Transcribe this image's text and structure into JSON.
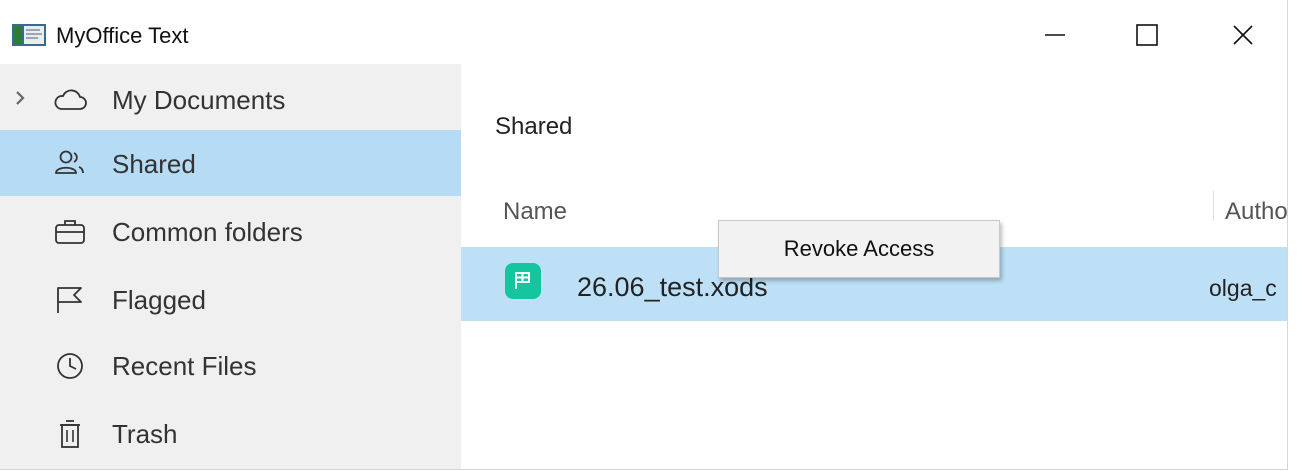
{
  "window": {
    "title": "MyOffice Text",
    "app_icon": "myoffice-text-app-icon",
    "controls": {
      "minimize_icon": "minimize-icon",
      "maximize_icon": "maximize-icon",
      "close_icon": "close-icon"
    }
  },
  "sidebar": {
    "items": [
      {
        "label": "My Documents",
        "icon": "cloud-icon",
        "expandable": true,
        "active": false
      },
      {
        "label": "Shared",
        "icon": "users-icon",
        "active": true
      },
      {
        "label": "Common folders",
        "icon": "briefcase-icon",
        "active": false
      },
      {
        "label": "Flagged",
        "icon": "flag-icon",
        "active": false
      },
      {
        "label": "Recent Files",
        "icon": "clock-icon",
        "active": false
      },
      {
        "label": "Trash",
        "icon": "trash-icon",
        "active": false
      }
    ]
  },
  "main": {
    "title": "Shared",
    "columns": {
      "name": "Name",
      "author": "Autho"
    },
    "files": [
      {
        "name": "26.06_test.xods",
        "author": "olga_c",
        "icon": "spreadsheet-file-icon",
        "selected": true
      }
    ]
  },
  "context_menu": {
    "items": [
      {
        "label": "Revoke Access"
      }
    ]
  },
  "colors": {
    "sidebar_bg": "#f0f0f0",
    "sidebar_active": "#b6dbf4",
    "row_selected": "#bde0f7",
    "file_icon": "#14c5a0"
  }
}
